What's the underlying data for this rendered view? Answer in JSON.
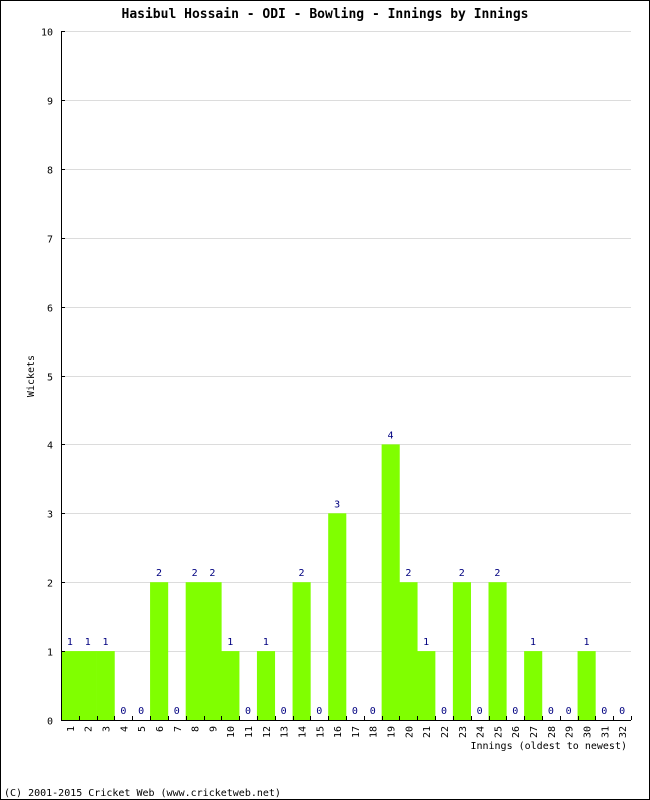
{
  "chart_data": {
    "type": "bar",
    "title": "Hasibul Hossain - ODI - Bowling - Innings by Innings",
    "xlabel": "Innings (oldest to newest)",
    "ylabel": "Wickets",
    "ylim": [
      0,
      10
    ],
    "yticks": [
      0,
      1,
      2,
      3,
      4,
      5,
      6,
      7,
      8,
      9,
      10
    ],
    "grid": true,
    "categories": [
      "1",
      "2",
      "3",
      "4",
      "5",
      "6",
      "7",
      "8",
      "9",
      "10",
      "11",
      "12",
      "13",
      "14",
      "15",
      "16",
      "17",
      "18",
      "19",
      "20",
      "21",
      "22",
      "23",
      "24",
      "25",
      "26",
      "27",
      "28",
      "29",
      "30",
      "31",
      "32"
    ],
    "values": [
      1,
      1,
      1,
      0,
      0,
      2,
      0,
      2,
      2,
      1,
      0,
      1,
      0,
      2,
      0,
      3,
      0,
      0,
      4,
      2,
      1,
      0,
      2,
      0,
      2,
      0,
      1,
      0,
      0,
      1,
      0,
      0
    ],
    "bar_color": "#80ff00",
    "label_color": "#000080"
  },
  "footer": "(C) 2001-2015 Cricket Web (www.cricketweb.net)"
}
